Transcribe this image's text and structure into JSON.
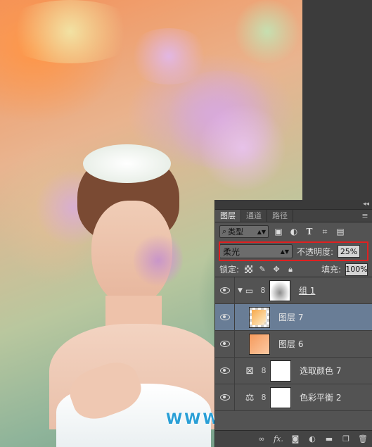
{
  "watermark": "WWW.PSAHZ.COM",
  "layers_panel": {
    "tabs": [
      {
        "label": "图层",
        "active": true
      },
      {
        "label": "通道",
        "active": false
      },
      {
        "label": "路径",
        "active": false
      }
    ],
    "filter": {
      "label": "类型",
      "icon": "search-icon"
    },
    "filter_icons": [
      "image-filter-icon",
      "adjustment-filter-icon",
      "type-filter-icon",
      "shape-filter-icon",
      "smart-object-filter-icon"
    ],
    "blend_mode": "柔光",
    "opacity_label": "不透明度:",
    "opacity_value": "25%",
    "lock_label": "锁定:",
    "fill_label": "填充:",
    "fill_value": "100%",
    "layers": [
      {
        "name": "组 1",
        "type": "group",
        "visible": true,
        "selected": false
      },
      {
        "name": "图层 7",
        "type": "pixel",
        "visible": true,
        "selected": true
      },
      {
        "name": "图层 6",
        "type": "pixel",
        "visible": true,
        "selected": false
      },
      {
        "name": "选取颜色 7",
        "type": "selective-color",
        "visible": true,
        "selected": false
      },
      {
        "name": "色彩平衡 2",
        "type": "color-balance",
        "visible": true,
        "selected": false
      }
    ],
    "bottom_icons": [
      "link-layers-icon",
      "fx-icon",
      "add-mask-icon",
      "new-adjustment-icon",
      "new-group-icon",
      "new-layer-icon",
      "delete-layer-icon"
    ],
    "colors": {
      "panel_bg": "#535353",
      "selected_layer": "#697d96",
      "highlight_box": "#e02020"
    }
  }
}
